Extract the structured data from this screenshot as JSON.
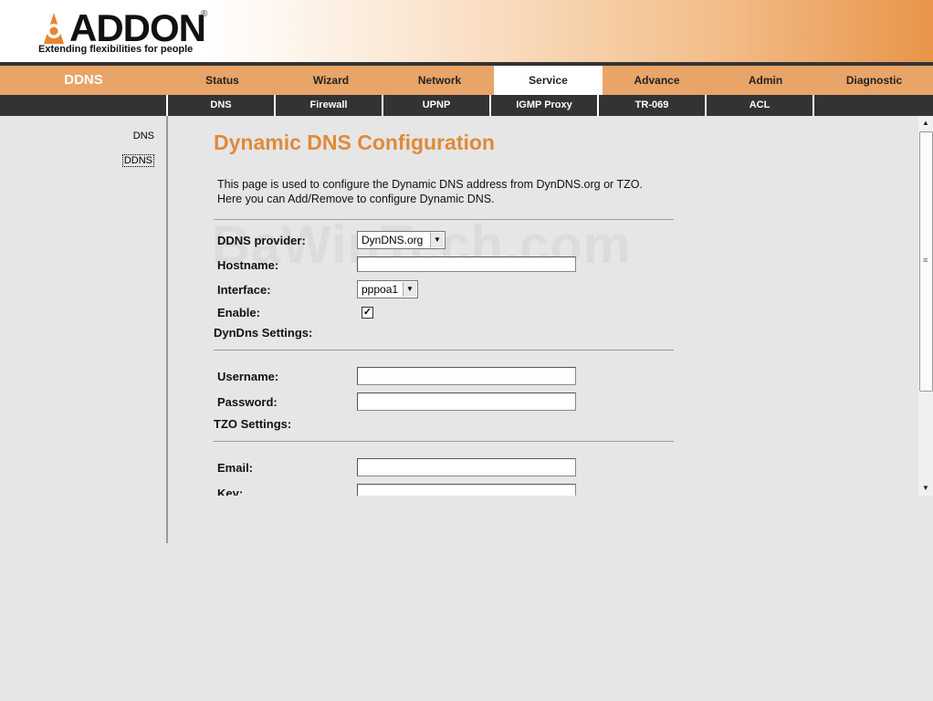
{
  "header": {
    "brand": "ADDON",
    "registered": "®",
    "tagline": "Extending flexibilities for people"
  },
  "mainnav": {
    "section_title": "DDNS",
    "tabs": [
      "Status",
      "Wizard",
      "Network",
      "Service",
      "Advance",
      "Admin",
      "Diagnostic"
    ],
    "active": "Service"
  },
  "subnav": {
    "tabs": [
      "DNS",
      "Firewall",
      "UPNP",
      "IGMP Proxy",
      "TR-069",
      "ACL"
    ]
  },
  "sidebar": {
    "items": [
      "DNS",
      "DDNS"
    ],
    "active": "DDNS"
  },
  "content": {
    "title": "Dynamic DNS Configuration",
    "intro_line1": "This page is used to configure the Dynamic DNS address from DynDNS.org or TZO.",
    "intro_line2": "Here you can Add/Remove to configure Dynamic DNS.",
    "watermark": "BaWinTech.com",
    "fields": {
      "provider_label": "DDNS provider:",
      "provider_value": "DynDNS.org",
      "hostname_label": "Hostname:",
      "hostname_value": "",
      "interface_label": "Interface:",
      "interface_value": "pppoa1",
      "enable_label": "Enable:",
      "enable_checked": true
    },
    "dyndns": {
      "heading": "DynDns Settings:",
      "username_label": "Username:",
      "password_label": "Password:"
    },
    "tzo": {
      "heading": "TZO Settings:",
      "email_label": "Email:",
      "key_label": "Key:"
    }
  },
  "colors": {
    "accent": "#e08a3a",
    "nav_bg": "#e9a468",
    "subnav_bg": "#333333",
    "page_bg": "#e6e6e6"
  },
  "icons": {
    "logo": "addon-logo-icon",
    "dropdown": "chevron-down-icon",
    "checkbox": "checkmark-icon",
    "scroll_up": "scroll-up-arrow-icon",
    "scroll_down": "scroll-down-arrow-icon"
  }
}
